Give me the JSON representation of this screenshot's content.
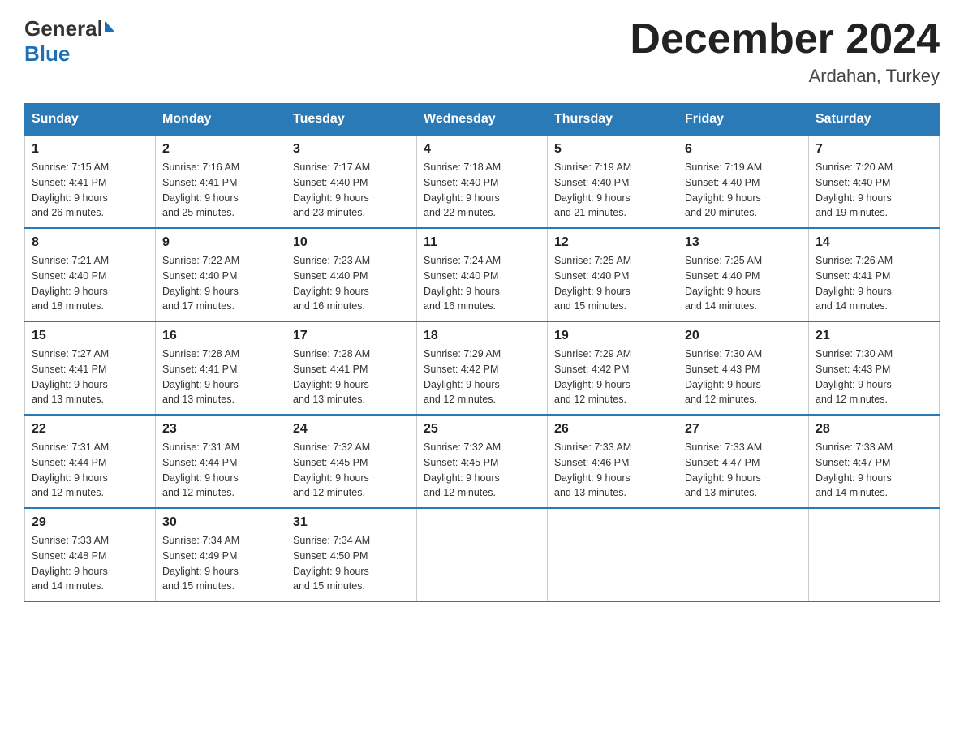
{
  "header": {
    "logo_general": "General",
    "logo_blue": "Blue",
    "month_title": "December 2024",
    "location": "Ardahan, Turkey"
  },
  "days_of_week": [
    "Sunday",
    "Monday",
    "Tuesday",
    "Wednesday",
    "Thursday",
    "Friday",
    "Saturday"
  ],
  "weeks": [
    [
      {
        "day": "1",
        "sunrise": "7:15 AM",
        "sunset": "4:41 PM",
        "daylight": "9 hours and 26 minutes."
      },
      {
        "day": "2",
        "sunrise": "7:16 AM",
        "sunset": "4:41 PM",
        "daylight": "9 hours and 25 minutes."
      },
      {
        "day": "3",
        "sunrise": "7:17 AM",
        "sunset": "4:40 PM",
        "daylight": "9 hours and 23 minutes."
      },
      {
        "day": "4",
        "sunrise": "7:18 AM",
        "sunset": "4:40 PM",
        "daylight": "9 hours and 22 minutes."
      },
      {
        "day": "5",
        "sunrise": "7:19 AM",
        "sunset": "4:40 PM",
        "daylight": "9 hours and 21 minutes."
      },
      {
        "day": "6",
        "sunrise": "7:19 AM",
        "sunset": "4:40 PM",
        "daylight": "9 hours and 20 minutes."
      },
      {
        "day": "7",
        "sunrise": "7:20 AM",
        "sunset": "4:40 PM",
        "daylight": "9 hours and 19 minutes."
      }
    ],
    [
      {
        "day": "8",
        "sunrise": "7:21 AM",
        "sunset": "4:40 PM",
        "daylight": "9 hours and 18 minutes."
      },
      {
        "day": "9",
        "sunrise": "7:22 AM",
        "sunset": "4:40 PM",
        "daylight": "9 hours and 17 minutes."
      },
      {
        "day": "10",
        "sunrise": "7:23 AM",
        "sunset": "4:40 PM",
        "daylight": "9 hours and 16 minutes."
      },
      {
        "day": "11",
        "sunrise": "7:24 AM",
        "sunset": "4:40 PM",
        "daylight": "9 hours and 16 minutes."
      },
      {
        "day": "12",
        "sunrise": "7:25 AM",
        "sunset": "4:40 PM",
        "daylight": "9 hours and 15 minutes."
      },
      {
        "day": "13",
        "sunrise": "7:25 AM",
        "sunset": "4:40 PM",
        "daylight": "9 hours and 14 minutes."
      },
      {
        "day": "14",
        "sunrise": "7:26 AM",
        "sunset": "4:41 PM",
        "daylight": "9 hours and 14 minutes."
      }
    ],
    [
      {
        "day": "15",
        "sunrise": "7:27 AM",
        "sunset": "4:41 PM",
        "daylight": "9 hours and 13 minutes."
      },
      {
        "day": "16",
        "sunrise": "7:28 AM",
        "sunset": "4:41 PM",
        "daylight": "9 hours and 13 minutes."
      },
      {
        "day": "17",
        "sunrise": "7:28 AM",
        "sunset": "4:41 PM",
        "daylight": "9 hours and 13 minutes."
      },
      {
        "day": "18",
        "sunrise": "7:29 AM",
        "sunset": "4:42 PM",
        "daylight": "9 hours and 12 minutes."
      },
      {
        "day": "19",
        "sunrise": "7:29 AM",
        "sunset": "4:42 PM",
        "daylight": "9 hours and 12 minutes."
      },
      {
        "day": "20",
        "sunrise": "7:30 AM",
        "sunset": "4:43 PM",
        "daylight": "9 hours and 12 minutes."
      },
      {
        "day": "21",
        "sunrise": "7:30 AM",
        "sunset": "4:43 PM",
        "daylight": "9 hours and 12 minutes."
      }
    ],
    [
      {
        "day": "22",
        "sunrise": "7:31 AM",
        "sunset": "4:44 PM",
        "daylight": "9 hours and 12 minutes."
      },
      {
        "day": "23",
        "sunrise": "7:31 AM",
        "sunset": "4:44 PM",
        "daylight": "9 hours and 12 minutes."
      },
      {
        "day": "24",
        "sunrise": "7:32 AM",
        "sunset": "4:45 PM",
        "daylight": "9 hours and 12 minutes."
      },
      {
        "day": "25",
        "sunrise": "7:32 AM",
        "sunset": "4:45 PM",
        "daylight": "9 hours and 12 minutes."
      },
      {
        "day": "26",
        "sunrise": "7:33 AM",
        "sunset": "4:46 PM",
        "daylight": "9 hours and 13 minutes."
      },
      {
        "day": "27",
        "sunrise": "7:33 AM",
        "sunset": "4:47 PM",
        "daylight": "9 hours and 13 minutes."
      },
      {
        "day": "28",
        "sunrise": "7:33 AM",
        "sunset": "4:47 PM",
        "daylight": "9 hours and 14 minutes."
      }
    ],
    [
      {
        "day": "29",
        "sunrise": "7:33 AM",
        "sunset": "4:48 PM",
        "daylight": "9 hours and 14 minutes."
      },
      {
        "day": "30",
        "sunrise": "7:34 AM",
        "sunset": "4:49 PM",
        "daylight": "9 hours and 15 minutes."
      },
      {
        "day": "31",
        "sunrise": "7:34 AM",
        "sunset": "4:50 PM",
        "daylight": "9 hours and 15 minutes."
      },
      null,
      null,
      null,
      null
    ]
  ],
  "labels": {
    "sunrise": "Sunrise:",
    "sunset": "Sunset:",
    "daylight": "Daylight:"
  }
}
